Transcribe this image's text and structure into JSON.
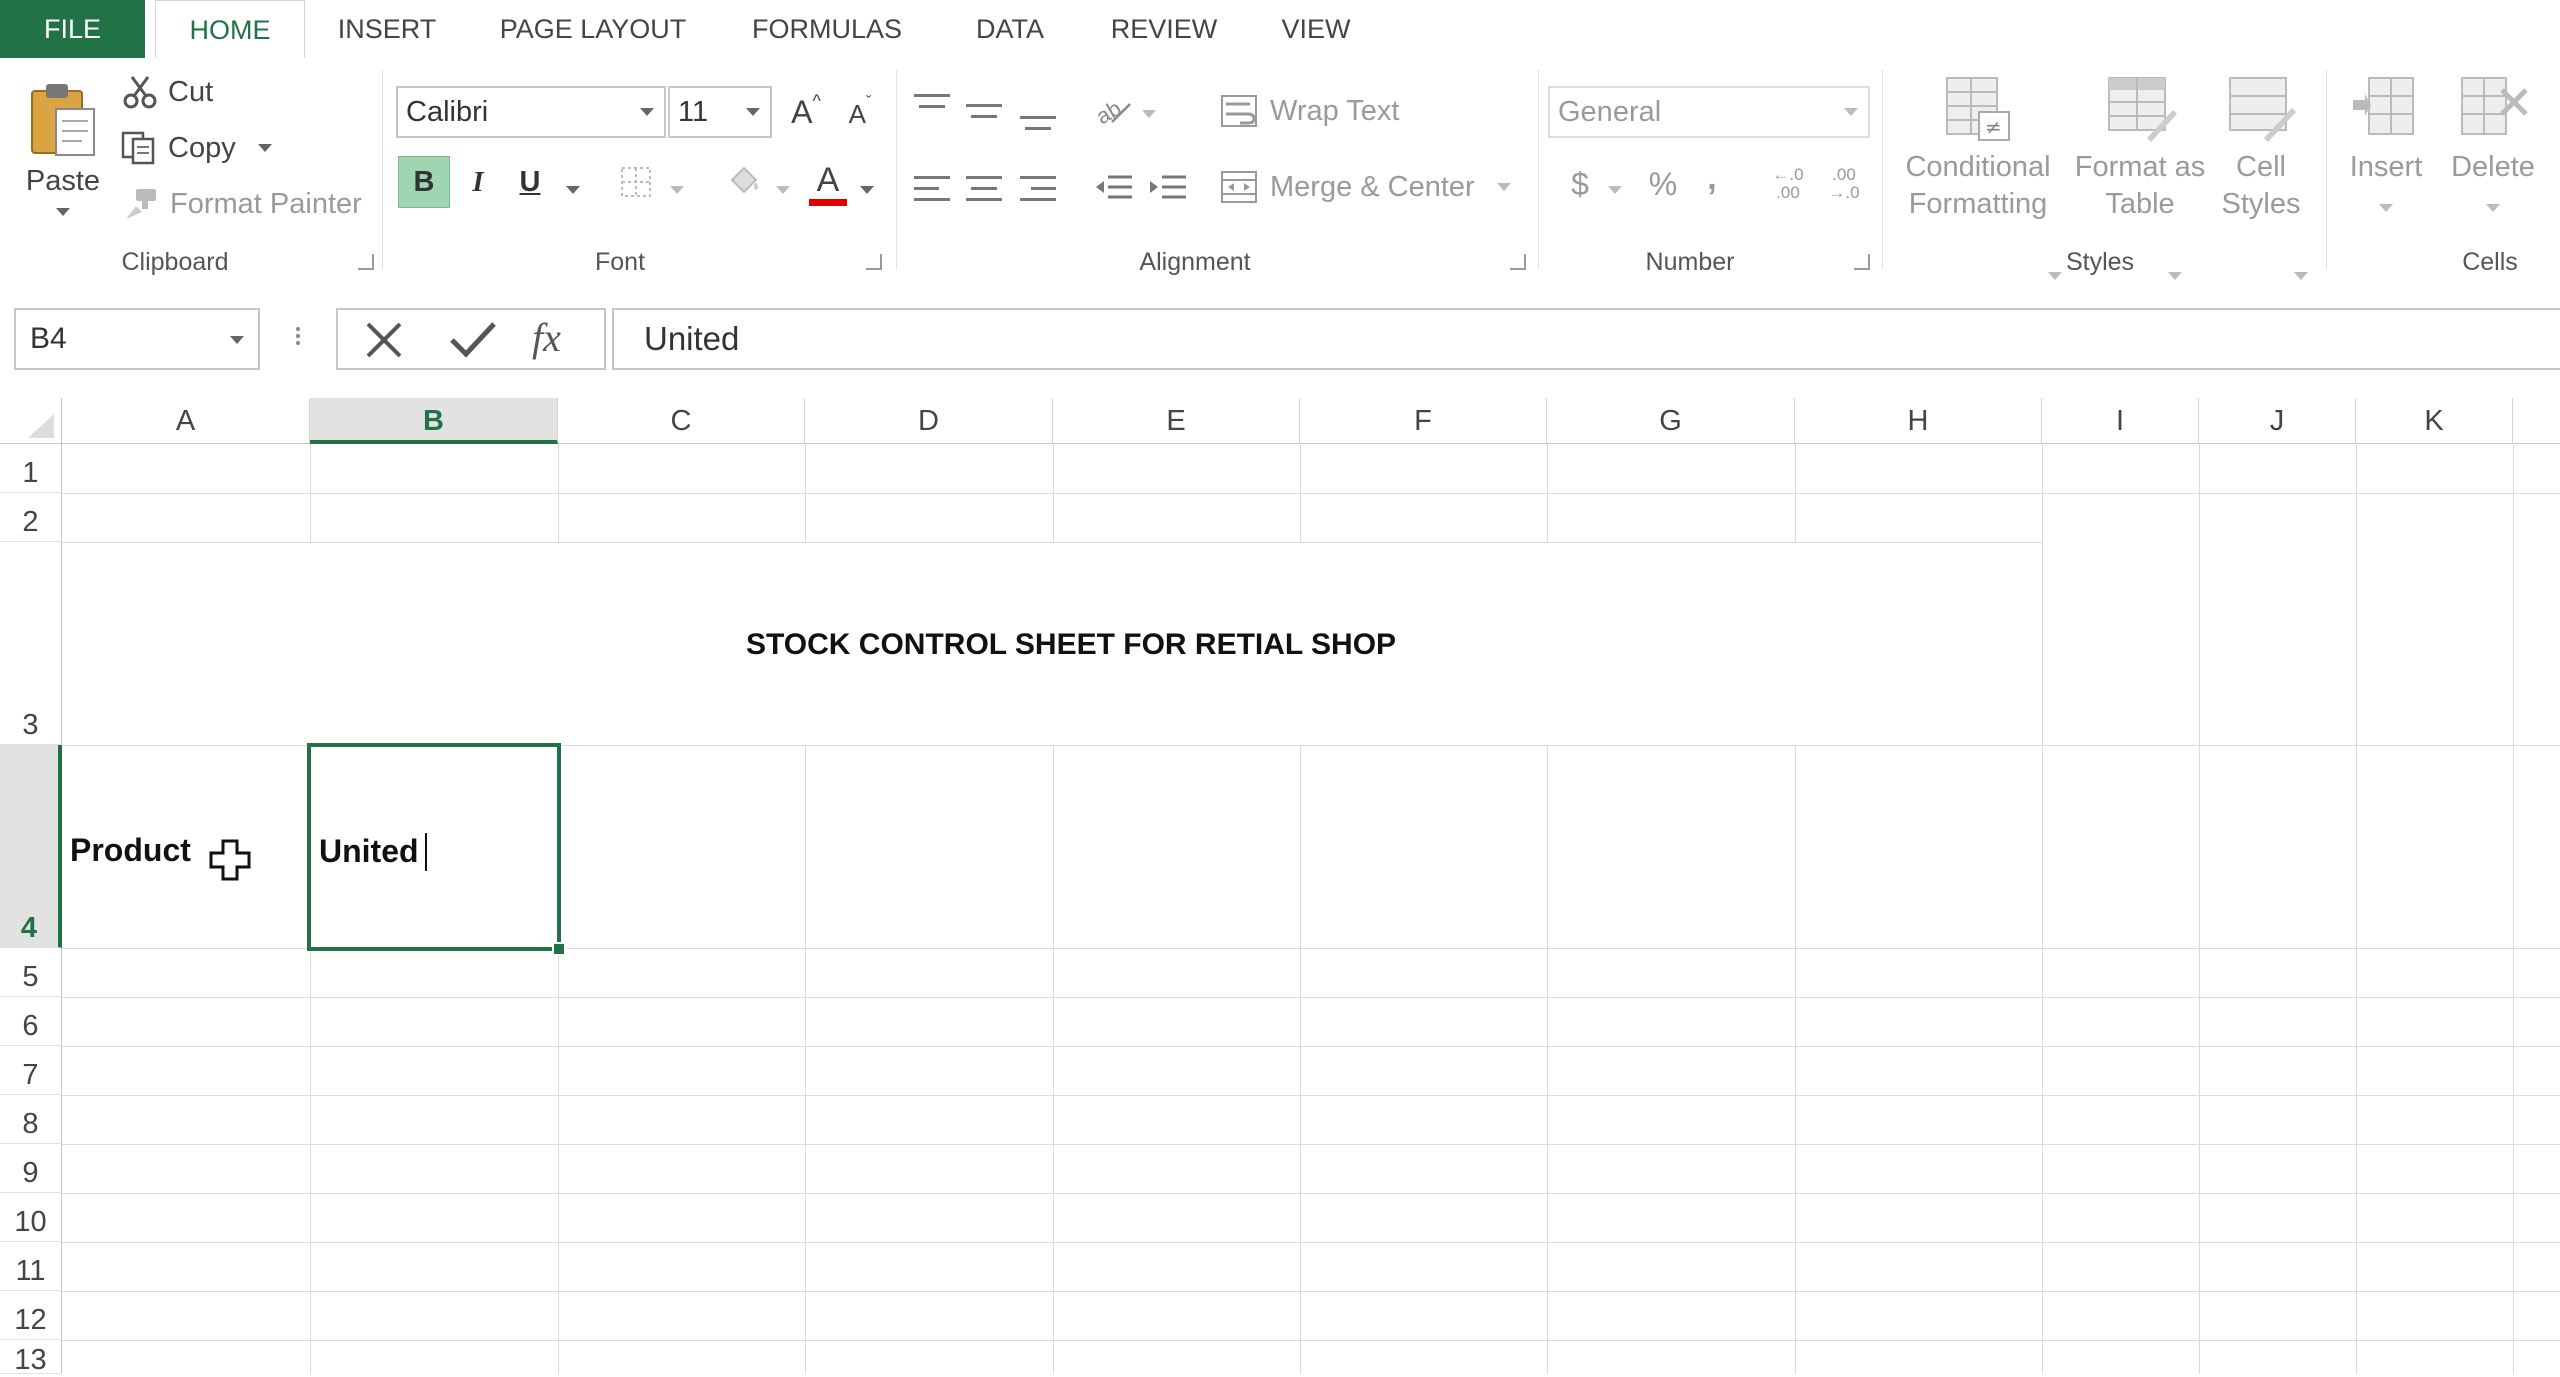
{
  "tabs": [
    "FILE",
    "HOME",
    "INSERT",
    "PAGE LAYOUT",
    "FORMULAS",
    "DATA",
    "REVIEW",
    "VIEW"
  ],
  "clipboard": {
    "paste": "Paste",
    "cut": "Cut",
    "copy": "Copy",
    "format_painter": "Format Painter",
    "label": "Clipboard"
  },
  "font": {
    "name": "Calibri",
    "size": "11",
    "bold": "B",
    "italic": "I",
    "underline": "U",
    "grow": "A",
    "shrink": "A",
    "font_color": "A",
    "label": "Font"
  },
  "alignment": {
    "wrap_text": "Wrap Text",
    "merge_center": "Merge & Center",
    "label": "Alignment"
  },
  "number": {
    "format": "General",
    "currency": "$",
    "percent": "%",
    "comma": ",",
    "inc_decimal": "←.0 .00",
    "dec_decimal": ".00 →.0",
    "label": "Number"
  },
  "styles": {
    "conditional_1": "Conditional",
    "conditional_2": "Formatting",
    "format_table_1": "Format as",
    "format_table_2": "Table",
    "cell_styles_1": "Cell",
    "cell_styles_2": "Styles",
    "label": "Styles"
  },
  "cells": {
    "insert": "Insert",
    "delete": "Delete",
    "label": "Cells"
  },
  "formula_bar": {
    "name_box": "B4",
    "fx": "fx",
    "content": "United"
  },
  "columns": [
    "A",
    "B",
    "C",
    "D",
    "E",
    "F",
    "G",
    "H",
    "I",
    "J",
    "K"
  ],
  "rows": [
    "1",
    "2",
    "3",
    "4",
    "5",
    "6",
    "7",
    "8",
    "9",
    "10",
    "11",
    "12",
    "13"
  ],
  "sheet": {
    "title": "STOCK CONTROL SHEET FOR RETIAL SHOP",
    "a4": "Product",
    "b4": "United"
  },
  "colors": {
    "accent": "#217346",
    "font_color_bar": "#e00000"
  },
  "icons": {
    "cancel": "x-icon",
    "enter": "check-icon",
    "cursor": "cross-cursor-icon"
  }
}
